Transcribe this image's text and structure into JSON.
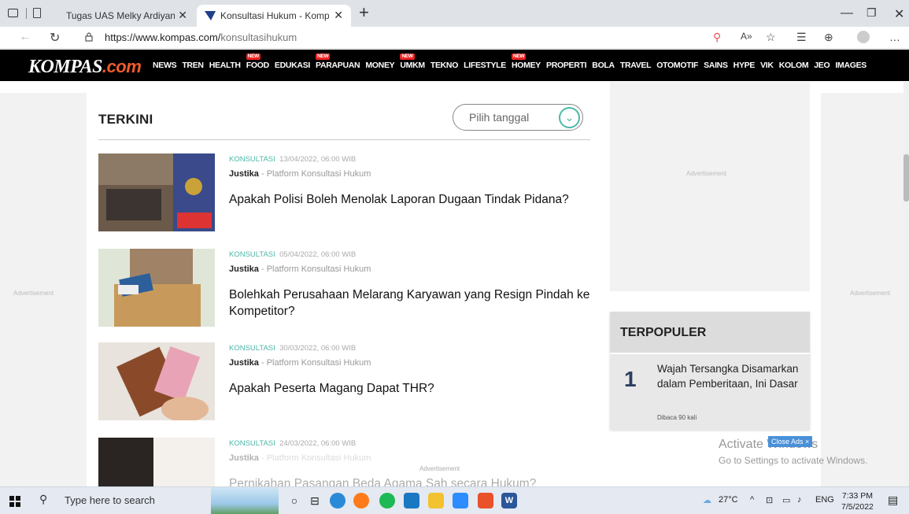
{
  "browser": {
    "tabs": [
      {
        "title": "Tugas UAS Melky Ardiyansa",
        "active": false
      },
      {
        "title": "Konsultasi Hukum - Kompas.com",
        "active": true
      }
    ],
    "url_host": "https://www.kompas.com/",
    "url_path": "konsultasihukum"
  },
  "site": {
    "logo_main": "KOMPAS",
    "logo_suffix": ".com",
    "nav": [
      {
        "label": "NEWS",
        "new": false
      },
      {
        "label": "TREN",
        "new": false
      },
      {
        "label": "HEALTH",
        "new": false
      },
      {
        "label": "FOOD",
        "new": true
      },
      {
        "label": "EDUKASI",
        "new": false
      },
      {
        "label": "PARAPUAN",
        "new": true
      },
      {
        "label": "MONEY",
        "new": false
      },
      {
        "label": "UMKM",
        "new": true
      },
      {
        "label": "TEKNO",
        "new": false
      },
      {
        "label": "LIFESTYLE",
        "new": false
      },
      {
        "label": "HOMEY",
        "new": true
      },
      {
        "label": "PROPERTI",
        "new": false
      },
      {
        "label": "BOLA",
        "new": false
      },
      {
        "label": "TRAVEL",
        "new": false
      },
      {
        "label": "OTOMOTIF",
        "new": false
      },
      {
        "label": "SAINS",
        "new": false
      },
      {
        "label": "HYPE",
        "new": false
      },
      {
        "label": "VIK",
        "new": false
      },
      {
        "label": "KOLOM",
        "new": false
      },
      {
        "label": "JEO",
        "new": false
      },
      {
        "label": "IMAGES",
        "new": false
      }
    ],
    "new_badge": "NEW"
  },
  "ads": {
    "label": "Advertisement",
    "close_ads": "Close Ads ×"
  },
  "main": {
    "section_title": "TERKINI",
    "date_placeholder": "Pilih tanggal",
    "articles": [
      {
        "category": "KONSULTASI",
        "date": "13/04/2022, 06:00 WIB",
        "source": "Justika",
        "source_desc": "- Platform Konsultasi Hukum",
        "title": "Apakah Polisi Boleh Menolak Laporan Dugaan Tindak Pidana?"
      },
      {
        "category": "KONSULTASI",
        "date": "05/04/2022, 06:00 WIB",
        "source": "Justika",
        "source_desc": "- Platform Konsultasi Hukum",
        "title": "Bolehkah Perusahaan Melarang Karyawan yang Resign Pindah ke Kompetitor?"
      },
      {
        "category": "KONSULTASI",
        "date": "30/03/2022, 06:00 WIB",
        "source": "Justika",
        "source_desc": "- Platform Konsultasi Hukum",
        "title": "Apakah Peserta Magang Dapat THR?"
      },
      {
        "category": "KONSULTASI",
        "date": "24/03/2022, 06:00 WIB",
        "source": "Justika",
        "source_desc": "- Platform Konsultasi Hukum",
        "title": "Pernikahan Pasangan Beda Agama Sah secara Hukum?"
      }
    ]
  },
  "terpopuler": {
    "title": "TERPOPULER",
    "items": [
      {
        "rank": "1",
        "title": "Wajah Tersangka Disamarkan dalam Pemberitaan, Ini Dasar",
        "reads": "Dibaca 90 kali"
      }
    ]
  },
  "watermark": {
    "line1": "Activate Windows",
    "line2": "Go to Settings to activate Windows."
  },
  "taskbar": {
    "search_placeholder": "Type here to search",
    "temperature": "27°C",
    "language": "ENG",
    "time": "7:33 PM",
    "date": "7/5/2022"
  }
}
